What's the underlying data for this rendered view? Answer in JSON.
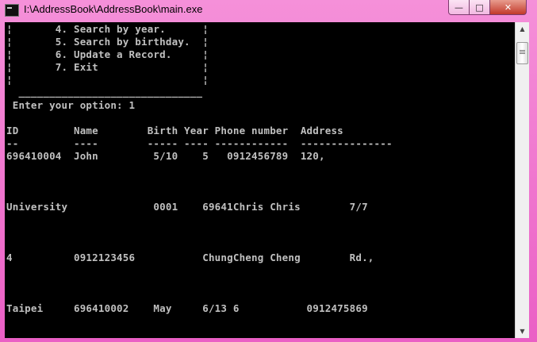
{
  "window": {
    "title": "I:\\AddressBook\\AddressBook\\main.exe",
    "controls": {
      "minimize": "—",
      "maximize": "□",
      "close": "✕"
    }
  },
  "console": {
    "lines": [
      "¦       4. Search by year.      ¦",
      "¦       5. Search by birthday.  ¦",
      "¦       6. Update a Record.     ¦",
      "¦       7. Exit                 ¦",
      "¦                               ¦",
      "  ______________________________",
      " Enter your option: 1",
      "",
      "ID         Name        Birth Year Phone number  Address",
      "--         ----        ----- ---- ------------  ---------------",
      "696410004  John         5/10    5   0912456789  120,",
      "",
      "",
      "",
      "University              0001    69641Chris Chris        7/7",
      "",
      "",
      "",
      "4          0912123456           ChungCheng Cheng        Rd.,",
      "",
      "",
      "",
      "Taipei     696410002    May     6/13 6           0912475869"
    ]
  },
  "scrollbar": {
    "up": "▲",
    "down": "▼"
  }
}
